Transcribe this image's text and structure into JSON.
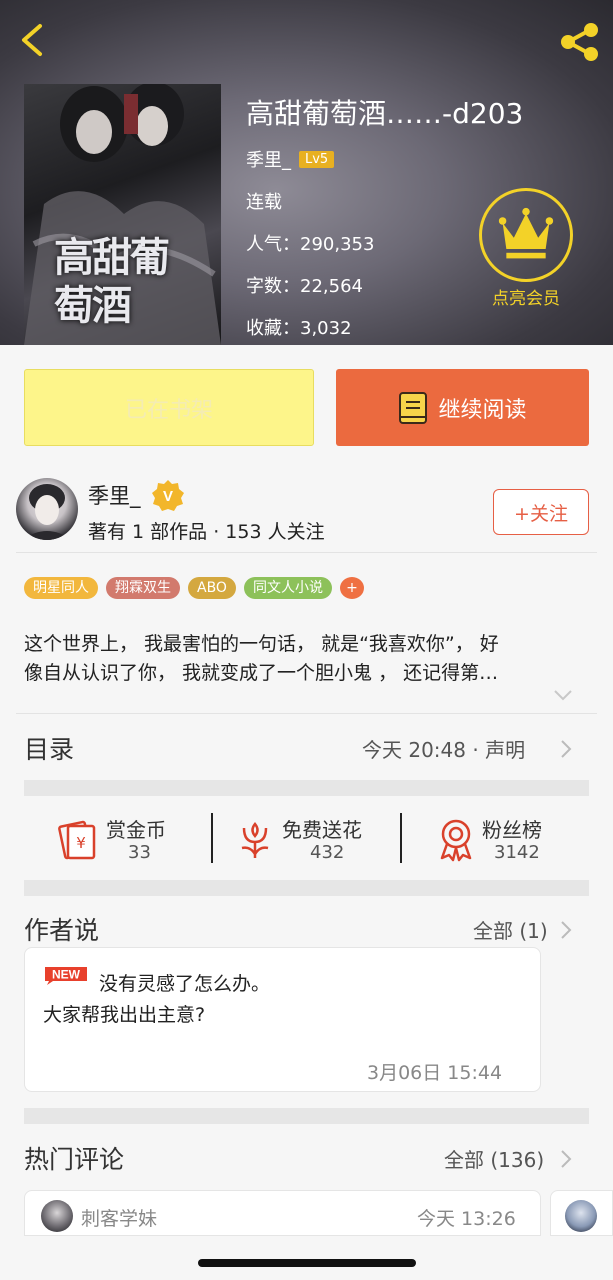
{
  "book": {
    "title": "高甜葡萄酒……-d203",
    "author": "季里_",
    "level": "Lv5",
    "status": "连载",
    "popularity": "人气：290,353",
    "words": "字数：22,564",
    "favorites": "收藏：3,032",
    "cover_text": "高甜葡萄酒"
  },
  "vip": {
    "label": "点亮会员"
  },
  "actions": {
    "shelf": "已在书架",
    "read": "继续阅读"
  },
  "author": {
    "name": "季里_",
    "stats": "著有 1 部作品 · 153 人关注",
    "follow": "+关注"
  },
  "tags": [
    {
      "label": "明星同人",
      "color": "#f2b73d"
    },
    {
      "label": "翔霖双生",
      "color": "#d27a6d"
    },
    {
      "label": "ABO",
      "color": "#d4a83f"
    },
    {
      "label": "同文人小说",
      "color": "#8dc15a"
    },
    {
      "label": "+",
      "color": "#ef7042"
    }
  ],
  "intro": {
    "line1": "这个世界上， 我最害怕的一句话， 就是“我喜欢你”， 好",
    "line2": "像自从认识了你， 我就变成了一个胆小鬼 ， 还记得第…"
  },
  "toc": {
    "title": "目录",
    "updated": "今天 20:48 · 声明"
  },
  "stats": [
    {
      "label": "赏金币",
      "value": "33",
      "icon": "coin-envelope-icon"
    },
    {
      "label": "免费送花",
      "value": "432",
      "icon": "flower-icon"
    },
    {
      "label": "粉丝榜",
      "value": "3142",
      "icon": "medal-icon"
    }
  ],
  "author_says": {
    "title": "作者说",
    "all": "全部 (1)",
    "badge": "NEW",
    "line1": "没有灵感了怎么办。",
    "line2": "大家帮我出出主意?",
    "time": "3月06日  15:44"
  },
  "hot_comments": {
    "title": "热门评论",
    "all": "全部 (136)",
    "first": {
      "user": "刺客学妹",
      "time": "今天 13:26"
    }
  },
  "colors": {
    "accent": "#eb6a3f",
    "gold": "#f3d228",
    "icon_red": "#d9412b"
  }
}
